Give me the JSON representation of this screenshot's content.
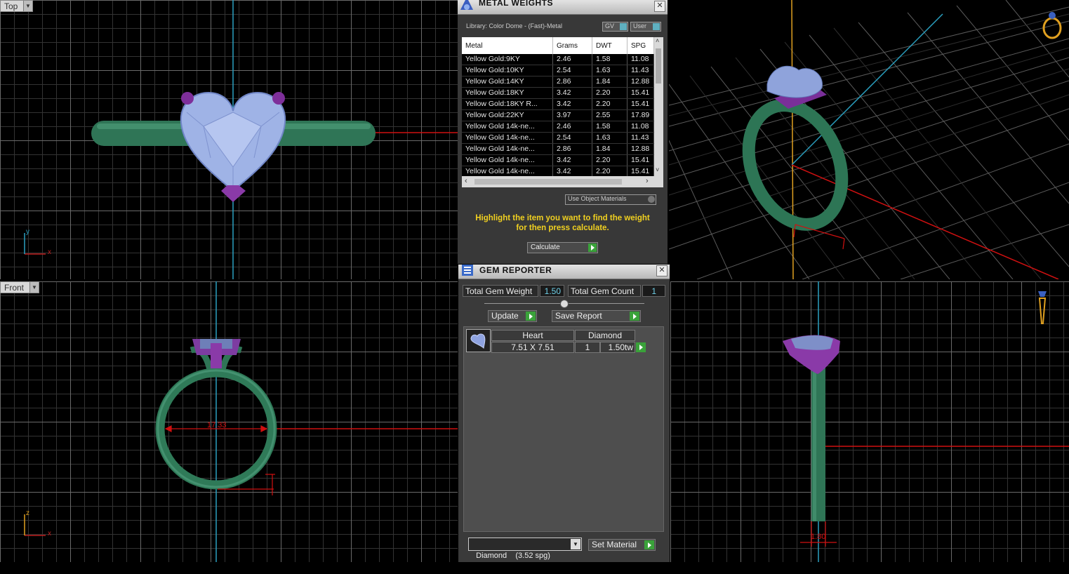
{
  "viewports": {
    "top": {
      "label": "Top",
      "axis_x": "x",
      "axis_y": "y"
    },
    "front": {
      "label": "Front",
      "axis_x": "x",
      "axis_z": "z",
      "dimension": "17.33"
    },
    "side": {
      "dimension": "1.80"
    }
  },
  "metal_weights": {
    "title": "METAL WEIGHTS",
    "library": "Library: Color Dome - (Fast)-Metal",
    "gv_label": "GV",
    "user_label": "User",
    "columns": [
      "Metal",
      "Grams",
      "DWT",
      "SPG"
    ],
    "rows": [
      [
        "Yellow Gold:9KY",
        "2.46",
        "1.58",
        "11.08"
      ],
      [
        "Yellow Gold:10KY",
        "2.54",
        "1.63",
        "11.43"
      ],
      [
        "Yellow Gold:14KY",
        "2.86",
        "1.84",
        "12.88"
      ],
      [
        "Yellow Gold:18KY",
        "3.42",
        "2.20",
        "15.41"
      ],
      [
        "Yellow Gold:18KY R...",
        "3.42",
        "2.20",
        "15.41"
      ],
      [
        "Yellow Gold:22KY",
        "3.97",
        "2.55",
        "17.89"
      ],
      [
        "Yellow Gold 14k-ne...",
        "2.46",
        "1.58",
        "11.08"
      ],
      [
        "Yellow Gold 14k-ne...",
        "2.54",
        "1.63",
        "11.43"
      ],
      [
        "Yellow Gold 14k-ne...",
        "2.86",
        "1.84",
        "12.88"
      ],
      [
        "Yellow Gold 14k-ne...",
        "3.42",
        "2.20",
        "15.41"
      ],
      [
        "Yellow Gold 14k-ne...",
        "3.42",
        "2.20",
        "15.41"
      ]
    ],
    "use_object_materials": "Use Object Materials",
    "instruction_line1": "Highlight the item you want to find the weight",
    "instruction_line2": "for then press calculate.",
    "calculate_label": "Calculate"
  },
  "gem_reporter": {
    "title": "GEM REPORTER",
    "total_weight_label": "Total Gem Weight",
    "total_weight_value": "1.50",
    "total_count_label": "Total Gem Count",
    "total_count_value": "1",
    "update_label": "Update",
    "save_report_label": "Save Report",
    "gem": {
      "shape": "Heart",
      "type": "Diamond",
      "size": "7.51 X 7.51",
      "count": "1",
      "weight": "1.50tw"
    },
    "material_select": "Diamond    (3.52 spg)",
    "set_material_label": "Set Material"
  },
  "colors": {
    "shank": "#2e7a5a",
    "gem": "#8fa6e0",
    "prong": "#8a3aa0",
    "dim_red": "#e01010"
  }
}
